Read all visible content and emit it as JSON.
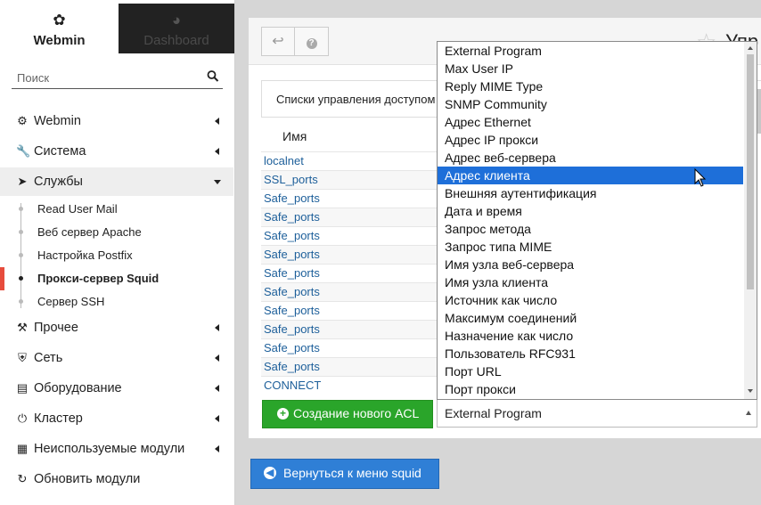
{
  "sidebar": {
    "tabs": {
      "webmin": "Webmin",
      "dashboard": "Dashboard"
    },
    "search_placeholder": "Поиск",
    "menu": [
      {
        "label": "Webmin",
        "icon": "gear-icon"
      },
      {
        "label": "Система",
        "icon": "wrench-icon"
      },
      {
        "label": "Службы",
        "icon": "rocket-icon"
      },
      {
        "label": "Прочее",
        "icon": "hammer-icon"
      },
      {
        "label": "Сеть",
        "icon": "shield-icon"
      },
      {
        "label": "Оборудование",
        "icon": "drive-icon"
      },
      {
        "label": "Кластер",
        "icon": "power-icon"
      },
      {
        "label": "Неиспользуемые модули",
        "icon": "puzzle-icon"
      },
      {
        "label": "Обновить модули",
        "icon": "refresh-icon"
      }
    ],
    "services_sub": [
      {
        "label": "Read User Mail"
      },
      {
        "label": "Веб сервер Apache"
      },
      {
        "label": "Настройка Postfix"
      },
      {
        "label": "Прокси-сервер Squid"
      },
      {
        "label": "Сервер SSH"
      }
    ]
  },
  "main": {
    "header_title": "Упр",
    "info_text": "Списки управления доступом",
    "column_name": "Имя",
    "acl_rows": [
      "localnet",
      "SSL_ports",
      "Safe_ports",
      "Safe_ports",
      "Safe_ports",
      "Safe_ports",
      "Safe_ports",
      "Safe_ports",
      "Safe_ports",
      "Safe_ports",
      "Safe_ports",
      "Safe_ports",
      "CONNECT"
    ],
    "create_button": "Создание нового ACL",
    "select_value": "External Program",
    "return_button": "Вернуться к меню squid",
    "link_peek": "i"
  },
  "dropdown": {
    "selected_index": 7,
    "options": [
      "External Program",
      "Max User IP",
      "Reply MIME Type",
      "SNMP Community",
      "Адрес Ethernet",
      "Адрес IP прокси",
      "Адрес веб-сервера",
      "Адрес клиента",
      "Внешняя аутентификация",
      "Дата и время",
      "Запрос метода",
      "Запрос типа MIME",
      "Имя узла веб-сервера",
      "Имя узла клиента",
      "Источник как число",
      "Максимум соединений",
      "Назначение как число",
      "Пользователь RFC931",
      "Порт URL",
      "Порт прокси"
    ]
  },
  "colors": {
    "accent_green": "#2aa52a",
    "accent_blue": "#2f7fd6",
    "selection": "#1e6fd9",
    "active_marker": "#e74c3c"
  }
}
